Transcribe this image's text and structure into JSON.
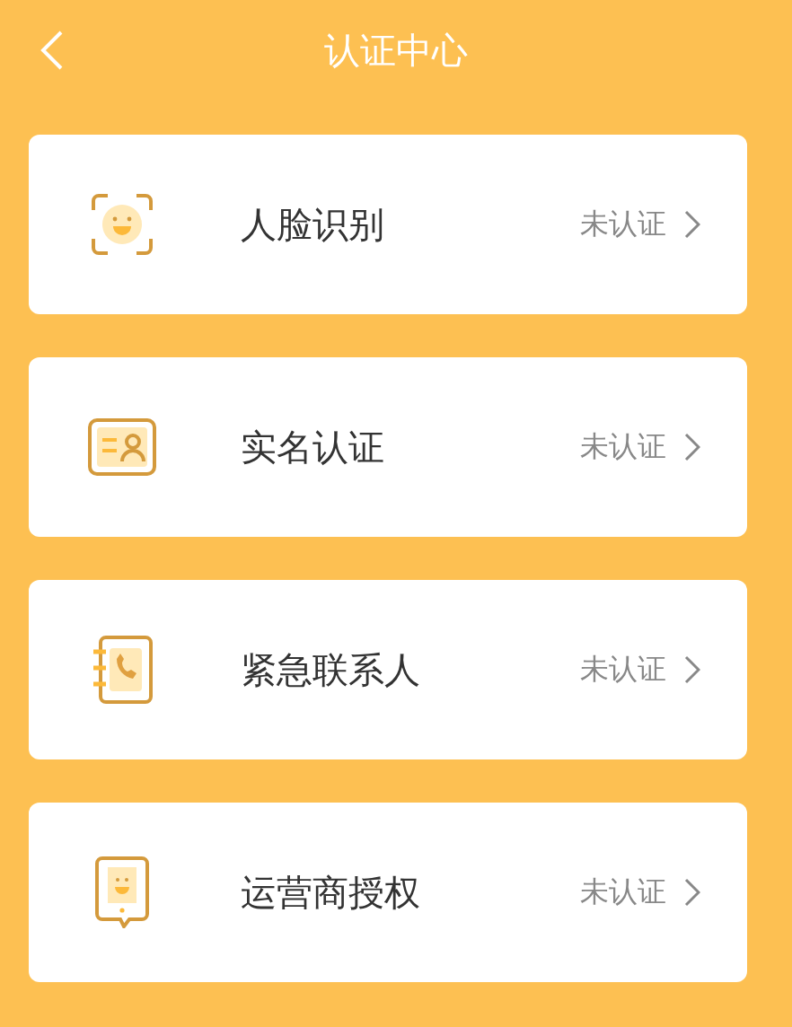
{
  "header": {
    "title": "认证中心"
  },
  "items": [
    {
      "kind": "face",
      "label": "人脸识别",
      "status": "未认证"
    },
    {
      "kind": "id",
      "label": "实名认证",
      "status": "未认证"
    },
    {
      "kind": "contact",
      "label": "紧急联系人",
      "status": "未认证"
    },
    {
      "kind": "carrier",
      "label": "运营商授权",
      "status": "未认证"
    }
  ]
}
